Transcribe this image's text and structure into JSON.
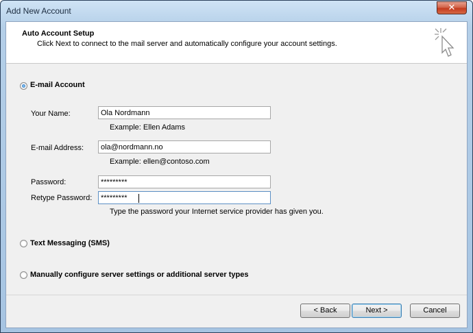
{
  "window": {
    "title": "Add New Account",
    "close_glyph": "✕"
  },
  "header": {
    "title": "Auto Account Setup",
    "subtitle": "Click Next to connect to the mail server and automatically configure your account settings.",
    "icon": "cursor-sparkle-icon"
  },
  "options": {
    "email": {
      "label": "E-mail Account",
      "selected": true
    },
    "sms": {
      "label": "Text Messaging (SMS)",
      "selected": false
    },
    "manual": {
      "label": "Manually configure server settings or additional server types",
      "selected": false
    }
  },
  "fields": {
    "name": {
      "label": "Your Name:",
      "value": "Ola Nordmann",
      "hint": "Example: Ellen Adams"
    },
    "email": {
      "label": "E-mail Address:",
      "value": "ola@nordmann.no",
      "hint": "Example: ellen@contoso.com"
    },
    "password": {
      "label": "Password:",
      "value": "*********"
    },
    "retype": {
      "label": "Retype Password:",
      "value": "*********",
      "hint": "Type the password your Internet service provider has given you."
    }
  },
  "buttons": {
    "back": "< Back",
    "next": "Next >",
    "cancel": "Cancel"
  },
  "colors": {
    "accent": "#1b5aa8",
    "client_bg": "#f0f0f0",
    "frame": "#a6c4e2",
    "close": "#c43b1f"
  }
}
